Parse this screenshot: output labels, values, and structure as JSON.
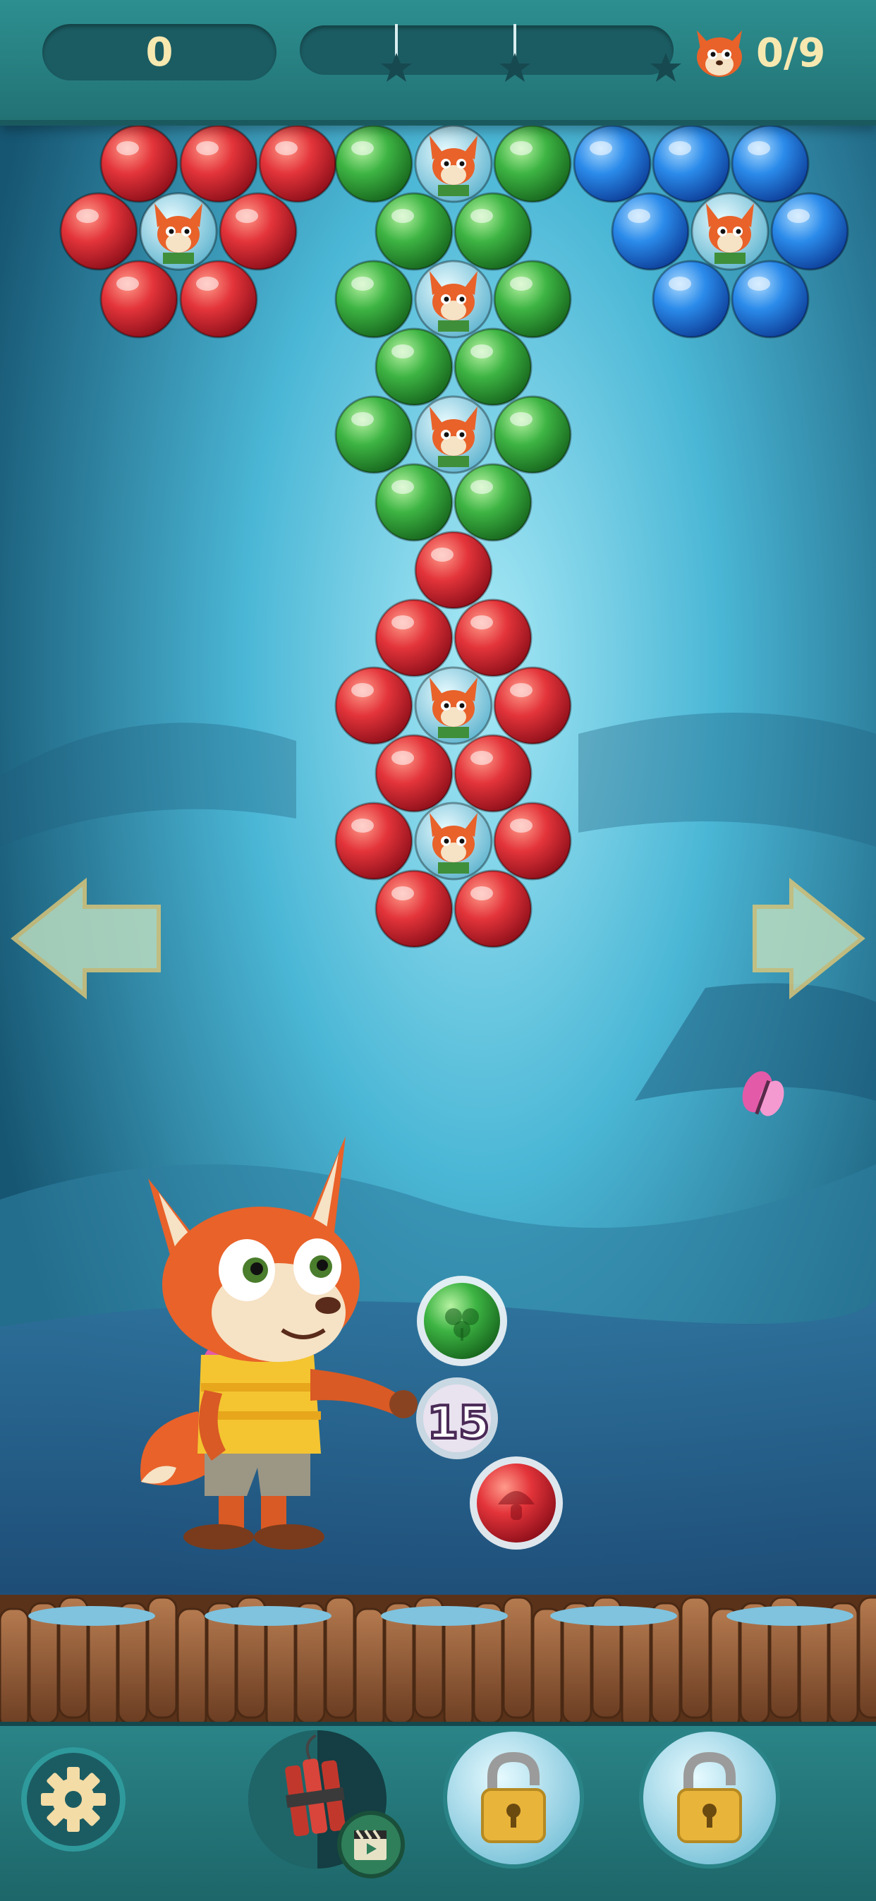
{
  "hud": {
    "score": "0",
    "fox_rescued": "0/9",
    "star_milestones": 3
  },
  "shooter": {
    "shots_left": "15",
    "current_bubble": "green-clover",
    "next_bubble": "red-mushroom"
  },
  "bottom_bar": {
    "settings": "gear-icon",
    "boosters": [
      {
        "name": "dynamite-booster",
        "state": "video-ad"
      },
      {
        "name": "locked-booster-1",
        "state": "locked"
      },
      {
        "name": "locked-booster-2",
        "state": "locked"
      }
    ]
  },
  "colors": {
    "red": "#d8262f",
    "green": "#2fa538",
    "blue": "#1f7ee0",
    "hud_text": "#f7e8b0",
    "hud_bg": "#1b5c62"
  }
}
